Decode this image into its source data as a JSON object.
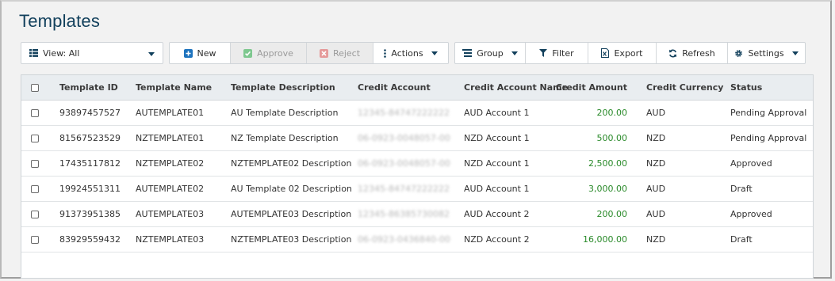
{
  "page": {
    "title": "Templates"
  },
  "toolbar": {
    "view_label": "View: All",
    "new_label": "New",
    "approve_label": "Approve",
    "reject_label": "Reject",
    "actions_label": "Actions",
    "group_label": "Group",
    "filter_label": "Filter",
    "export_label": "Export",
    "refresh_label": "Refresh",
    "settings_label": "Settings"
  },
  "colors": {
    "title": "#12405c",
    "accent_blue": "#1e73be",
    "approve_green": "#3eb35b",
    "reject_red": "#e05050",
    "amount_green": "#2a8a2a"
  },
  "icons": {
    "view": "list-view-icon",
    "new": "plus-square-icon",
    "approve": "check-square-icon",
    "reject": "x-square-icon",
    "actions": "vertical-ellipsis-icon",
    "group": "group-list-icon",
    "filter": "funnel-icon",
    "export": "excel-export-icon",
    "refresh": "refresh-icon",
    "settings": "gear-icon",
    "dropdown": "caret-down-icon"
  },
  "table": {
    "columns": [
      "Template ID",
      "Template Name",
      "Template Description",
      "Credit Account",
      "Credit Account Name",
      "Credit Amount",
      "Credit Currency",
      "Status"
    ],
    "rows": [
      {
        "id": "93897457527",
        "name": "AUTEMPLATE01",
        "description": "AU Template Description",
        "account": "12345-84747222222",
        "account_name": "AUD Account 1",
        "amount": "200.00",
        "currency": "AUD",
        "status": "Pending Approval"
      },
      {
        "id": "81567523529",
        "name": "NZTEMPLATE01",
        "description": "NZ Template Description",
        "account": "06-0923-0048057-00",
        "account_name": "NZD Account 1",
        "amount": "500.00",
        "currency": "NZD",
        "status": "Pending Approval"
      },
      {
        "id": "17435117812",
        "name": "NZTEMPLATE02",
        "description": "NZTEMPLATE02 Description",
        "account": "06-0923-0048057-00",
        "account_name": "NZD Account 1",
        "amount": "2,500.00",
        "currency": "NZD",
        "status": "Approved"
      },
      {
        "id": "19924551311",
        "name": "AUTEMPLATE02",
        "description": "AU Template 02 Description",
        "account": "12345-84747222222",
        "account_name": "AUD Account 1",
        "amount": "3,000.00",
        "currency": "AUD",
        "status": "Draft"
      },
      {
        "id": "91373951385",
        "name": "AUTEMPLATE03",
        "description": "AUTEMPLATE03 Description",
        "account": "12345-86385730082",
        "account_name": "AUD Account 2",
        "amount": "200.00",
        "currency": "AUD",
        "status": "Approved"
      },
      {
        "id": "83929559432",
        "name": "NZTEMPLATE03",
        "description": "NZTEMPLATE03 Description",
        "account": "06-0923-0436840-00",
        "account_name": "NZD Account 2",
        "amount": "16,000.00",
        "currency": "NZD",
        "status": "Draft"
      }
    ]
  }
}
